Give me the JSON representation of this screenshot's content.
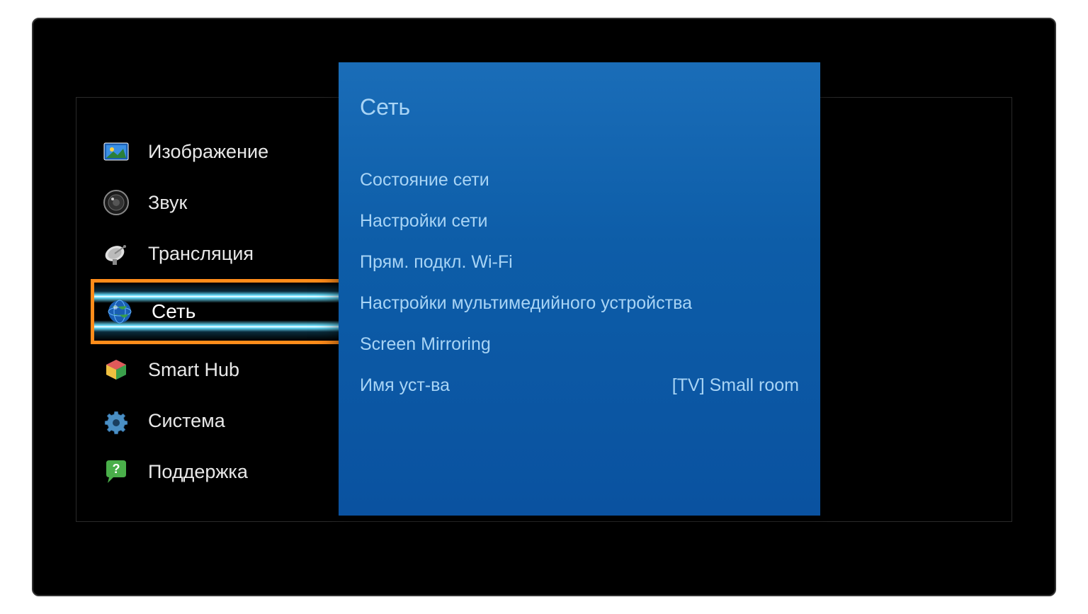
{
  "sidebar": {
    "items": [
      {
        "label": "Изображение",
        "icon": "picture"
      },
      {
        "label": "Звук",
        "icon": "sound"
      },
      {
        "label": "Трансляция",
        "icon": "broadcast"
      },
      {
        "label": "Сеть",
        "icon": "network",
        "selected": true
      },
      {
        "label": "Smart Hub",
        "icon": "smarthub"
      },
      {
        "label": "Система",
        "icon": "system"
      },
      {
        "label": "Поддержка",
        "icon": "support"
      }
    ]
  },
  "panel": {
    "title": "Сеть",
    "items": [
      {
        "label": "Состояние сети",
        "value": ""
      },
      {
        "label": "Настройки сети",
        "value": ""
      },
      {
        "label": "Прям. подкл. Wi-Fi",
        "value": ""
      },
      {
        "label": "Настройки мультимедийного устройства",
        "value": ""
      },
      {
        "label": "Screen Mirroring",
        "value": ""
      },
      {
        "label": "Имя уст-ва",
        "value": "[TV] Small room"
      }
    ]
  }
}
